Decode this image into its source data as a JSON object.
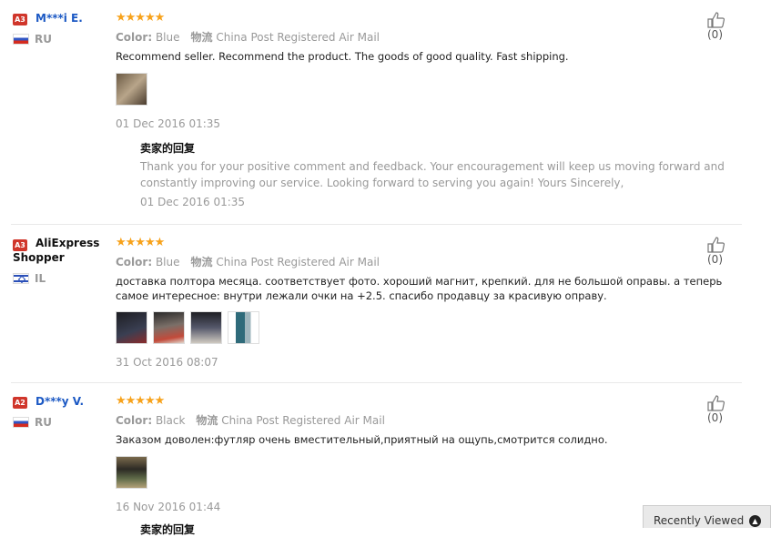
{
  "reviews": [
    {
      "badge": "A3",
      "username": "M***i E.",
      "country": "RU",
      "stars": "★★★★★",
      "color_label": "Color:",
      "color_value": "Blue",
      "shipping_label": "物流",
      "shipping_value": "China Post Registered Air Mail",
      "text": "Recommend seller. Recommend the product. The goods of good quality. Fast shipping.",
      "date": "01 Dec 2016 01:35",
      "likes": "(0)",
      "reply": {
        "title": "卖家的回复",
        "text": "Thank you for your positive comment and feedback. Your encouragement will keep us moving forward and constantly improving our service. Looking forward to serving you again! Yours Sincerely,",
        "date": "01 Dec 2016 01:35"
      }
    },
    {
      "badge": "A3",
      "username": "AliExpress Shopper",
      "country": "IL",
      "stars": "★★★★★",
      "color_label": "Color:",
      "color_value": "Blue",
      "shipping_label": "物流",
      "shipping_value": "China Post Registered Air Mail",
      "text": "доставка полтора месяца. соответствует фото. хороший магнит, крепкий. для не большой оправы. а теперь самое интересное: внутри лежали очки на +2.5. спасибо продавцу за красивую оправу.",
      "date": "31 Oct 2016 08:07",
      "likes": "(0)"
    },
    {
      "badge": "A2",
      "username": "D***y V.",
      "country": "RU",
      "stars": "★★★★★",
      "color_label": "Color:",
      "color_value": "Black",
      "shipping_label": "物流",
      "shipping_value": "China Post Registered Air Mail",
      "text": "Заказом доволен:футляр очень вместительный,приятный на ощупь,смотрится солидно.",
      "date": "16 Nov 2016 01:44",
      "likes": "(0)",
      "reply": {
        "title": "卖家的回复"
      }
    }
  ],
  "recently_viewed": {
    "label": "Recently Viewed",
    "icon": "chevron-up-icon"
  },
  "colors": {
    "username": "#1c59c4",
    "badge": "#d0362b",
    "stars": "#f7a21b"
  }
}
